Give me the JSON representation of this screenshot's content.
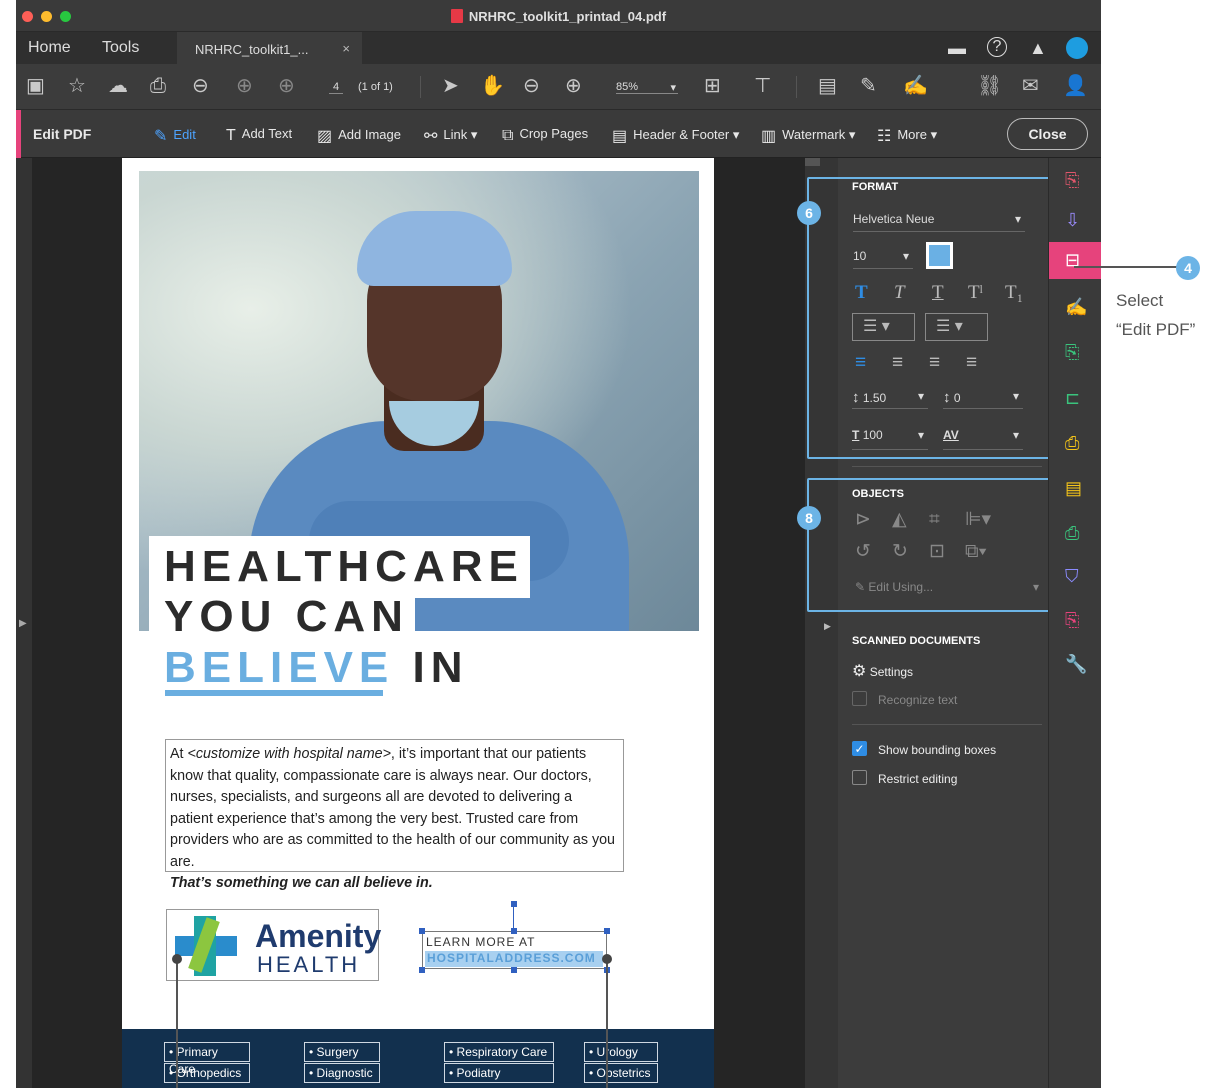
{
  "window": {
    "title": "NRHRC_toolkit1_printad_04.pdf"
  },
  "tabbar": {
    "home": "Home",
    "tools": "Tools",
    "doc_tab": "NRHRC_toolkit1_...",
    "close_tab": "×"
  },
  "toolbar": {
    "page_number": "4",
    "page_of": "(1 of 1)",
    "zoom": "85%"
  },
  "editbar": {
    "title": "Edit PDF",
    "edit": "Edit",
    "add_text": "Add Text",
    "add_image": "Add Image",
    "link": "Link",
    "crop_pages": "Crop Pages",
    "header_footer": "Header & Footer",
    "watermark": "Watermark",
    "more": "More",
    "close": "Close"
  },
  "document": {
    "headline": [
      "HEALTHCARE",
      "YOU CAN",
      "BELIEVE",
      "IN"
    ],
    "paragraph": {
      "p1": "At ",
      "p_italic": "<customize with hospital name>",
      "p2": ", it’s important that our patients know that quality, compassionate care is always near. Our doctors, nurses, specialists, and surgeons all are devoted to delivering a patient experience that’s among the very best. Trusted care from providers who are as committed to the health of our community as you are.",
      "closing": "That’s something we can all believe in."
    },
    "logo": {
      "name1": "Amenity",
      "name2": "HEALTH"
    },
    "learn_more": "LEARN MORE AT",
    "address": "HOSPITALADDRESS.COM",
    "services": [
      [
        "• Primary Care",
        "• Orthopedics"
      ],
      [
        "• Surgery",
        "• Diagnostic"
      ],
      [
        "• Respiratory Care",
        "• Podiatry"
      ],
      [
        "• Urology",
        "• Obstetrics"
      ]
    ]
  },
  "format_panel": {
    "heading": "FORMAT",
    "font": "Helvetica Neue",
    "size": "10",
    "line_spacing": "1.50",
    "para_spacing": "0",
    "scale": "100",
    "tracking_label": "AV",
    "font_color": "#6ab0e4"
  },
  "objects_panel": {
    "heading": "OBJECTS",
    "edit_using": "Edit Using..."
  },
  "scanned": {
    "heading": "SCANNED DOCUMENTS",
    "settings": "Settings",
    "recognize": "Recognize text"
  },
  "options": {
    "show_bounding": "Show bounding boxes",
    "show_bounding_checked": true,
    "restrict": "Restrict editing",
    "restrict_checked": false
  },
  "callouts": {
    "six": "6",
    "eight": "8",
    "four": "4",
    "annotation_line1": "Select",
    "annotation_line2": "“Edit PDF”"
  },
  "colors": {
    "accent_pink": "#e6437c",
    "accent_blue": "#6cb4e6",
    "selection_blue": "#2f8de4",
    "footer_navy": "#12304e"
  }
}
